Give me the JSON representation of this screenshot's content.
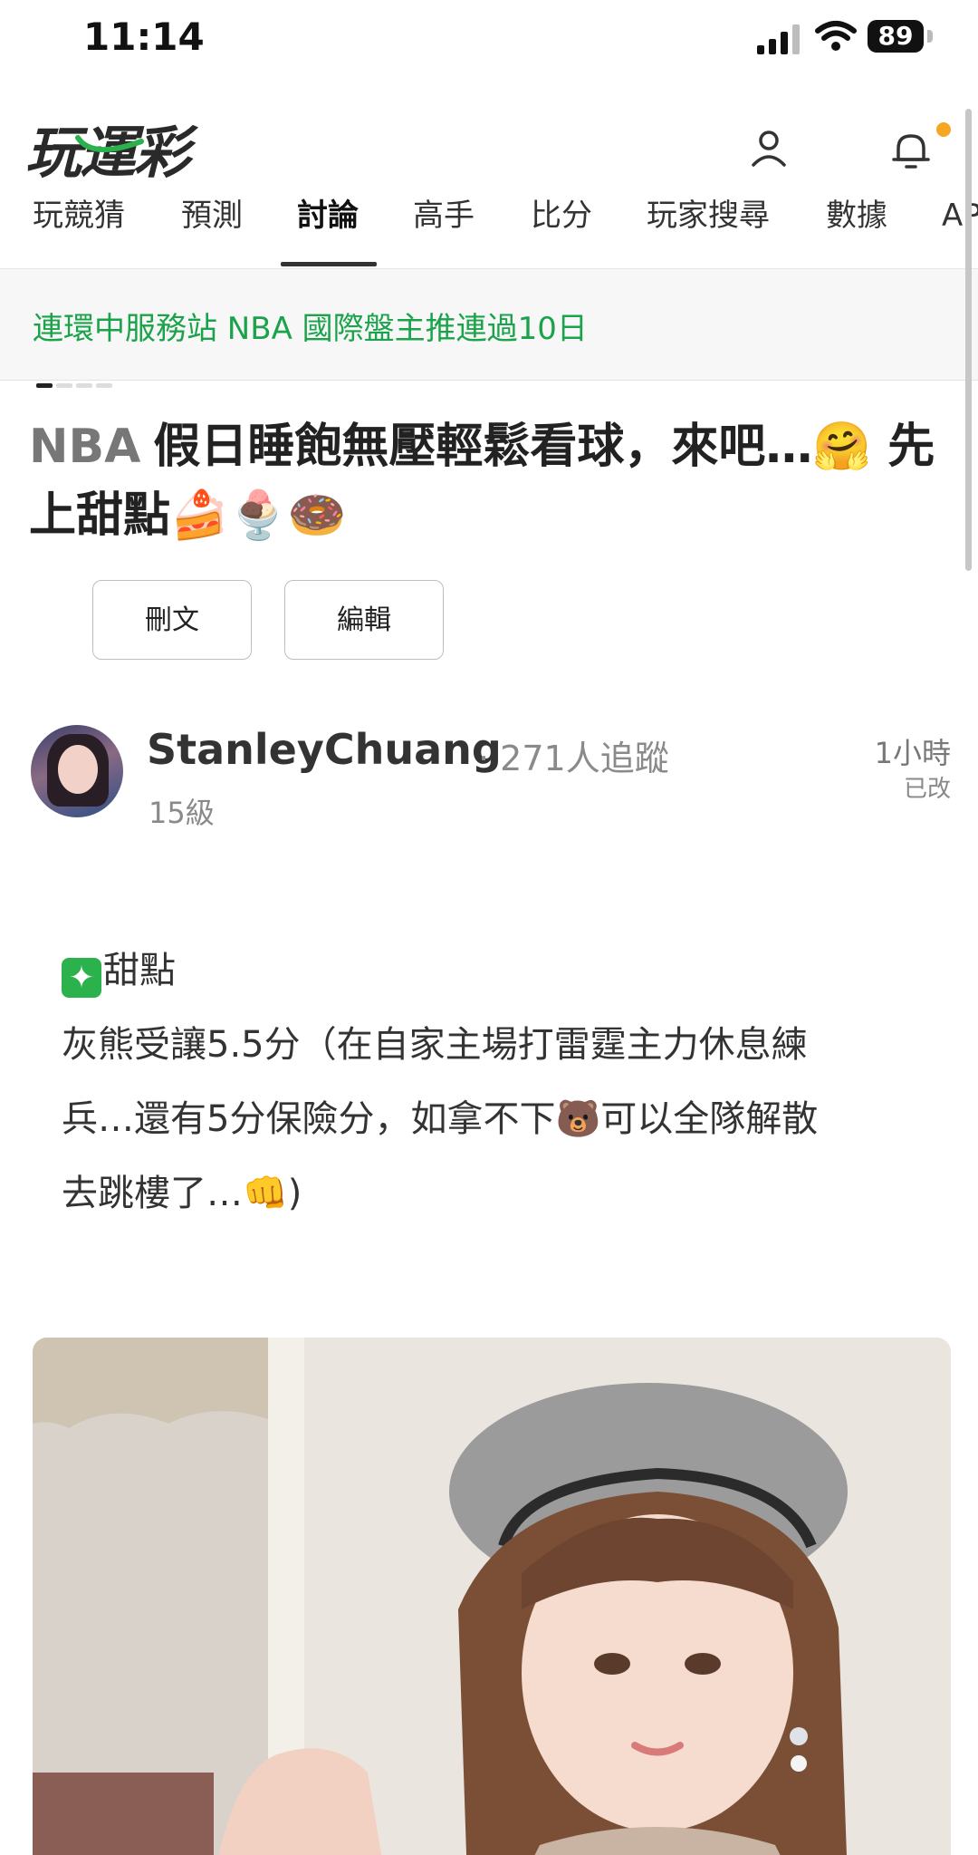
{
  "status_bar": {
    "time": "11:14",
    "battery": "89"
  },
  "header": {
    "logo": "玩運彩"
  },
  "tabs": [
    {
      "label": "玩競猜"
    },
    {
      "label": "預測"
    },
    {
      "label": "討論"
    },
    {
      "label": "高手"
    },
    {
      "label": "比分"
    },
    {
      "label": "玩家搜尋"
    },
    {
      "label": "數據"
    },
    {
      "label": "AP"
    }
  ],
  "banner": {
    "text": "連環中服務站 NBA 國際盤主推連過10日"
  },
  "post": {
    "league": "NBA",
    "title": "假日睡飽無壓輕鬆看球，來吧…🤗 先上甜點🍰🍨🍩",
    "actions": {
      "delete": "刪文",
      "edit": "編輯"
    },
    "author": {
      "name": "StanleyChuang",
      "followers": "· 271人追蹤",
      "level": "15級"
    },
    "time": "1小時",
    "edited": "已改",
    "body": {
      "heading": "甜點",
      "line1": "灰熊受讓5.5分（在自家主場打雷霆主力休息練",
      "line2": "兵…還有5分保險分，如拿不下🐻可以全隊解散",
      "line3": "去跳樓了…👊)"
    }
  },
  "colors": {
    "accent_green": "#1aa34a",
    "notification_dot": "#f5a623"
  }
}
